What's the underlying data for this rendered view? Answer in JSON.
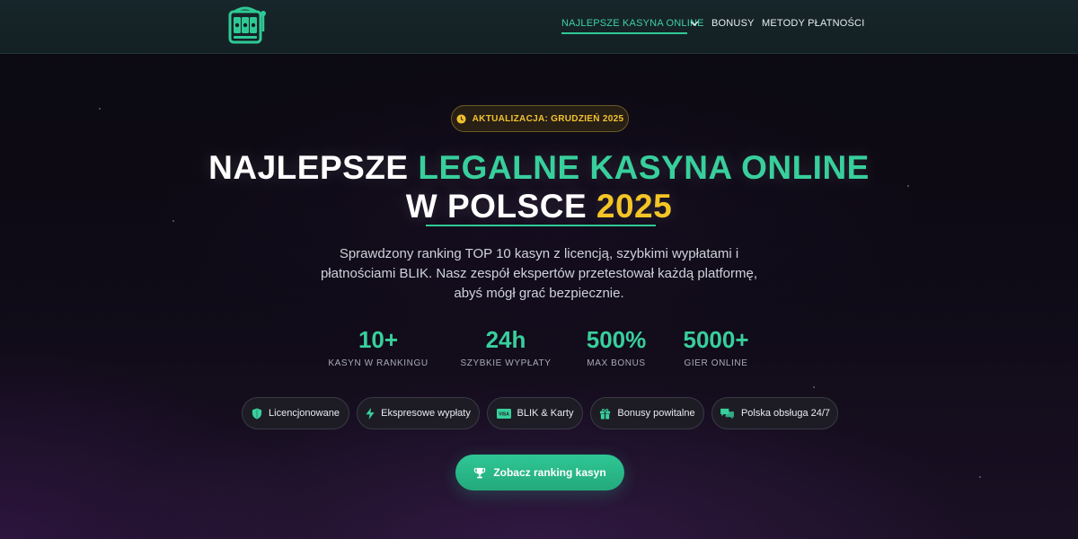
{
  "header": {
    "nav": {
      "best_casinos": "NAJLEPSZE KASYNA ONLINE",
      "bonuses": "BONUSY",
      "payment_methods": "METODY PŁATNOŚCI"
    }
  },
  "hero": {
    "badge": "AKTUALIZACJA: GRUDZIEŃ 2025",
    "title_line1_white": "NAJLEPSZE ",
    "title_line1_green": "LEGALNE KASYNA ONLINE",
    "title_line2_white": "W POLSCE ",
    "title_line2_gold": "2025",
    "description": [
      "Sprawdzony ranking TOP 10 kasyn z licencją, szybkimi wypłatami i",
      "płatnościami BLIK. Nasz zespół ekspertów przetestował każdą platformę,",
      "abyś mógł grać bezpiecznie."
    ]
  },
  "stats": [
    {
      "value": "10+",
      "label": "KASYN W RANKINGU"
    },
    {
      "value": "24h",
      "label": "SZYBKIE WYPŁATY"
    },
    {
      "value": "500%",
      "label": "MAX BONUS"
    },
    {
      "value": "5000+",
      "label": "GIER ONLINE"
    }
  ],
  "features": [
    {
      "label": "Licencjonowane",
      "icon": "shield-icon"
    },
    {
      "label": "Ekspresowe wypłaty",
      "icon": "lightning-icon"
    },
    {
      "label": "BLIK & Karty",
      "icon": "visa-card-icon",
      "icon_text": "VISA"
    },
    {
      "label": "Bonusy powitalne",
      "icon": "gift-icon"
    },
    {
      "label": "Polska obsługa 24/7",
      "icon": "chat-icon"
    }
  ],
  "cta": {
    "label": "Zobacz ranking kasyn",
    "icon": "trophy-icon"
  },
  "colors": {
    "accent_green": "#38cf9c",
    "accent_gold": "#f4c526",
    "header_bg": "#17262a",
    "page_bg": "#0d0a14"
  }
}
